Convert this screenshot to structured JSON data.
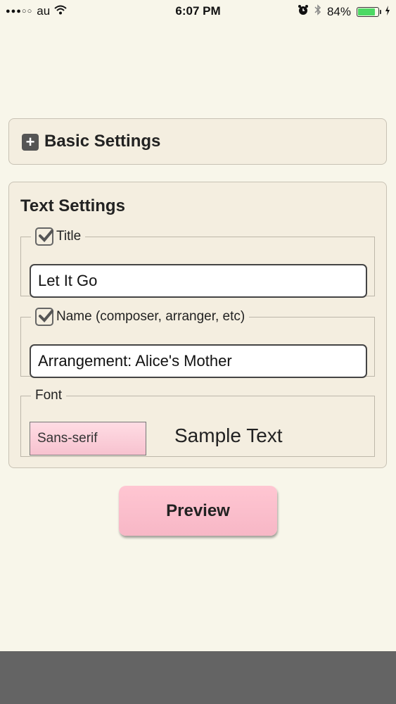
{
  "status_bar": {
    "carrier": "au",
    "time": "6:07 PM",
    "battery_percent": "84%",
    "battery_level": 0.84
  },
  "basic_settings": {
    "title": "Basic Settings",
    "icon": "plus-square-icon"
  },
  "text_settings": {
    "title": "Text Settings",
    "title_field": {
      "label": "Title",
      "checked": true,
      "value": "Let It Go"
    },
    "name_field": {
      "label": "Name (composer, arranger, etc)",
      "checked": true,
      "value": "Arrangement: Alice's Mother"
    },
    "font_field": {
      "label": "Font",
      "selected": "Sans-serif",
      "sample": "Sample Text"
    }
  },
  "preview_label": "Preview",
  "colors": {
    "background": "#f8f6ea",
    "pink_accent": "#f7b7c6",
    "battery_green": "#4cd964",
    "bottom_bar": "#646464"
  }
}
